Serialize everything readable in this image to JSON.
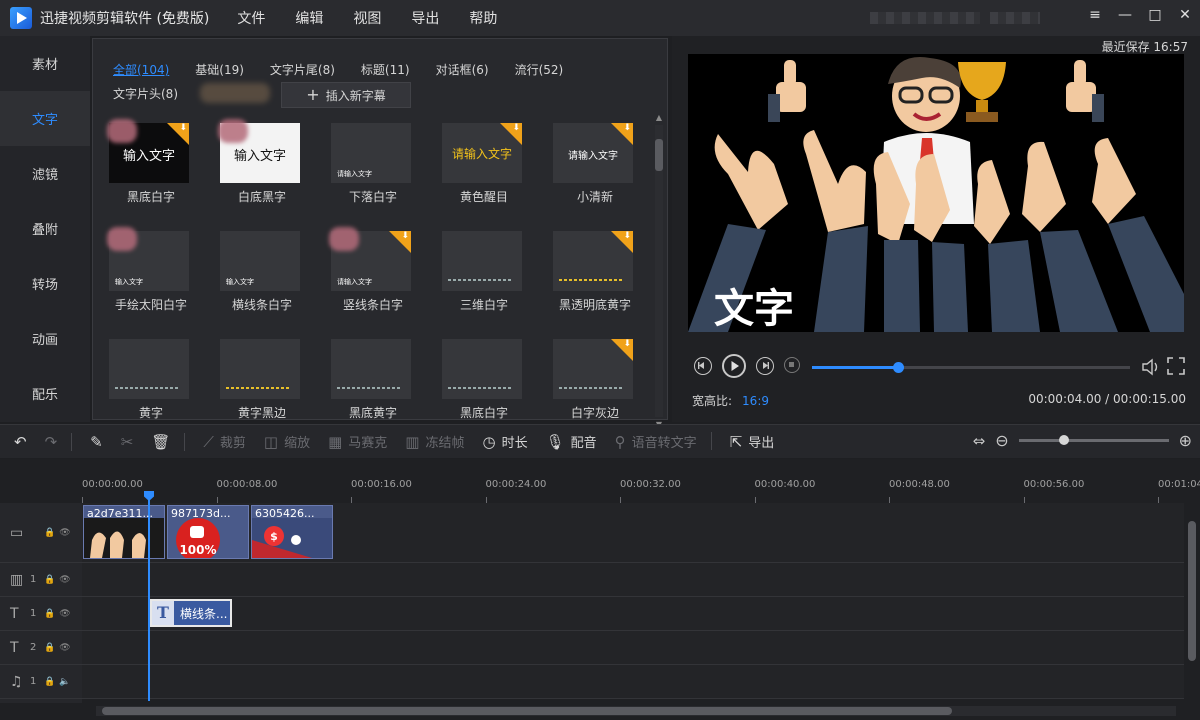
{
  "app": {
    "title": "迅捷视频剪辑软件 (免费版)",
    "menu": [
      "文件",
      "编辑",
      "视图",
      "导出",
      "帮助"
    ],
    "window_controls": [
      "≡",
      "—",
      "□",
      "✕"
    ]
  },
  "sidebar": {
    "items": [
      {
        "label": "素材",
        "active": false
      },
      {
        "label": "文字",
        "active": true
      },
      {
        "label": "滤镜",
        "active": false
      },
      {
        "label": "叠附",
        "active": false
      },
      {
        "label": "转场",
        "active": false
      },
      {
        "label": "动画",
        "active": false
      },
      {
        "label": "配乐",
        "active": false
      }
    ]
  },
  "library": {
    "categories": [
      "全部(104)",
      "基础(19)",
      "文字片尾(8)",
      "标题(11)",
      "对话框(6)",
      "流行(52)"
    ],
    "category2": "文字片头(8)",
    "insert_button": "插入新字幕",
    "tiles": [
      {
        "label": "黑底白字",
        "thumb_text": "输入文字",
        "style": "black",
        "download": true
      },
      {
        "label": "白底黑字",
        "thumb_text": "输入文字",
        "style": "white",
        "download": false
      },
      {
        "label": "下落白字",
        "thumb_text": "请输入文字",
        "style": "tiny",
        "download": false
      },
      {
        "label": "黄色醒目",
        "thumb_text": "请输入文字",
        "style": "yellow",
        "download": true
      },
      {
        "label": "小清新",
        "thumb_text": "请输入文字",
        "style": "small",
        "download": true
      },
      {
        "label": "手绘太阳白字",
        "thumb_text": "输入文字",
        "style": "tiny",
        "download": false
      },
      {
        "label": "横线条白字",
        "thumb_text": "输入文字",
        "style": "tiny",
        "download": false
      },
      {
        "label": "竖线条白字",
        "thumb_text": "请输入文字",
        "style": "tiny",
        "download": true
      },
      {
        "label": "三维白字",
        "thumb_text": "",
        "style": "stripe",
        "download": false
      },
      {
        "label": "黑透明底黄字",
        "thumb_text": "",
        "style": "stripe-yel",
        "download": true
      },
      {
        "label": "黄字",
        "thumb_text": "",
        "style": "stripe",
        "download": false
      },
      {
        "label": "黄字黑边",
        "thumb_text": "",
        "style": "stripe-yel",
        "download": false
      },
      {
        "label": "黑底黄字",
        "thumb_text": "",
        "style": "stripe",
        "download": false
      },
      {
        "label": "黑底白字",
        "thumb_text": "",
        "style": "stripe",
        "download": false
      },
      {
        "label": "白字灰边",
        "thumb_text": "",
        "style": "stripe",
        "download": true
      }
    ]
  },
  "preview": {
    "last_saved": "最近保存 16:57",
    "caption": "文字",
    "aspect_label": "宽高比:",
    "aspect_value": "16:9",
    "timecode": "00:00:04.00 / 00:00:15.00",
    "progress": 0.27
  },
  "toolbar": {
    "items": [
      {
        "label": "裁剪",
        "icon": "⟋",
        "dim": true
      },
      {
        "label": "缩放",
        "icon": "◫",
        "dim": true
      },
      {
        "label": "马赛克",
        "icon": "▦",
        "dim": true
      },
      {
        "label": "冻结帧",
        "icon": "▥",
        "dim": true
      },
      {
        "label": "时长",
        "icon": "◷",
        "dim": false
      },
      {
        "label": "配音",
        "icon": "🎙",
        "dim": false
      },
      {
        "label": "语音转文字",
        "icon": "⚲",
        "dim": true
      },
      {
        "label": "导出",
        "icon": "⇱",
        "dim": false
      }
    ],
    "zoom_level": 0.3
  },
  "timeline": {
    "ruler": [
      "00:00:00.00",
      "00:00:08.00",
      "00:00:16.00",
      "00:00:24.00",
      "00:00:32.00",
      "00:00:40.00",
      "00:00:48.00",
      "00:00:56.00",
      "00:01:04"
    ],
    "tracks": [
      {
        "icon": "video-track-icon",
        "num": ""
      },
      {
        "icon": "filmstrip-icon",
        "num": "1"
      },
      {
        "icon": "text-track-icon",
        "num": "1"
      },
      {
        "icon": "text-track-icon",
        "num": "2"
      },
      {
        "icon": "music-track-icon",
        "num": "1"
      }
    ],
    "video_clips": [
      "a2d7e311...",
      "987173d...",
      "6305426..."
    ],
    "text_clip": "横线条..."
  }
}
